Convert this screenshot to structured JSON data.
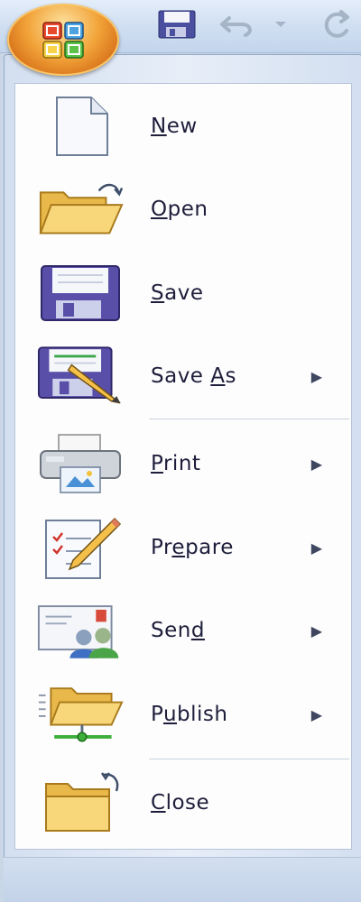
{
  "toolbar": {
    "office_button_icon": "office-logo-icon",
    "save_icon": "floppy-disk-icon",
    "undo_icon": "undo-icon",
    "undo_dropdown_icon": "chevron-down-icon",
    "redo_icon": "redo-icon"
  },
  "menu": {
    "items": [
      {
        "label_pre": "",
        "label_u": "N",
        "label_post": "ew",
        "icon": "new-document-icon",
        "has_submenu": false
      },
      {
        "label_pre": "",
        "label_u": "O",
        "label_post": "pen",
        "icon": "open-folder-icon",
        "has_submenu": false
      },
      {
        "label_pre": "",
        "label_u": "S",
        "label_post": "ave",
        "icon": "save-floppy-icon",
        "has_submenu": false
      },
      {
        "label_pre": "Save ",
        "label_u": "A",
        "label_post": "s",
        "icon": "save-as-icon",
        "has_submenu": true
      },
      {
        "label_pre": "",
        "label_u": "P",
        "label_post": "rint",
        "icon": "printer-icon",
        "has_submenu": true
      },
      {
        "label_pre": "Pr",
        "label_u": "e",
        "label_post": "pare",
        "icon": "prepare-checklist-icon",
        "has_submenu": true
      },
      {
        "label_pre": "Sen",
        "label_u": "d",
        "label_post": "",
        "icon": "send-envelope-icon",
        "has_submenu": true
      },
      {
        "label_pre": "P",
        "label_u": "u",
        "label_post": "blish",
        "icon": "publish-folder-icon",
        "has_submenu": true
      },
      {
        "label_pre": "",
        "label_u": "C",
        "label_post": "lose",
        "icon": "close-folder-icon",
        "has_submenu": false
      }
    ],
    "submenu_arrow": "▶"
  },
  "colors": {
    "accent_orange": "#f2a43a",
    "label_text": "#1e1e3c",
    "floppy_purple": "#5a4fa8",
    "folder_yellow": "#f6cf6a"
  }
}
